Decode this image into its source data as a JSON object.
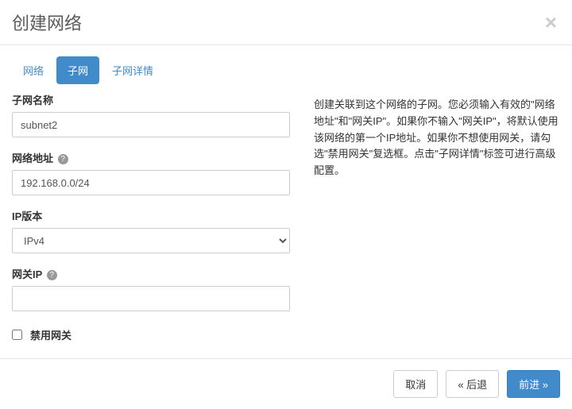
{
  "header": {
    "title": "创建网络"
  },
  "tabs": {
    "network": "网络",
    "subnet": "子网",
    "subnet_detail": "子网详情"
  },
  "form": {
    "subnet_name_label": "子网名称",
    "subnet_name_value": "subnet2",
    "network_address_label": "网络地址",
    "network_address_value": "192.168.0.0/24",
    "ip_version_label": "IP版本",
    "ip_version_value": "IPv4",
    "gateway_ip_label": "网关IP",
    "gateway_ip_value": "",
    "disable_gateway_label": "禁用网关"
  },
  "description": {
    "text": "创建关联到这个网络的子网。您必须输入有效的\"网络地址\"和\"网关IP\"。如果你不输入\"网关IP\"，将默认使用该网络的第一个IP地址。如果你不想使用网关，请勾选\"禁用网关\"复选框。点击\"子网详情\"标签可进行高级配置。"
  },
  "footer": {
    "cancel": "取消",
    "back": "« 后退",
    "next": "前进 »"
  }
}
